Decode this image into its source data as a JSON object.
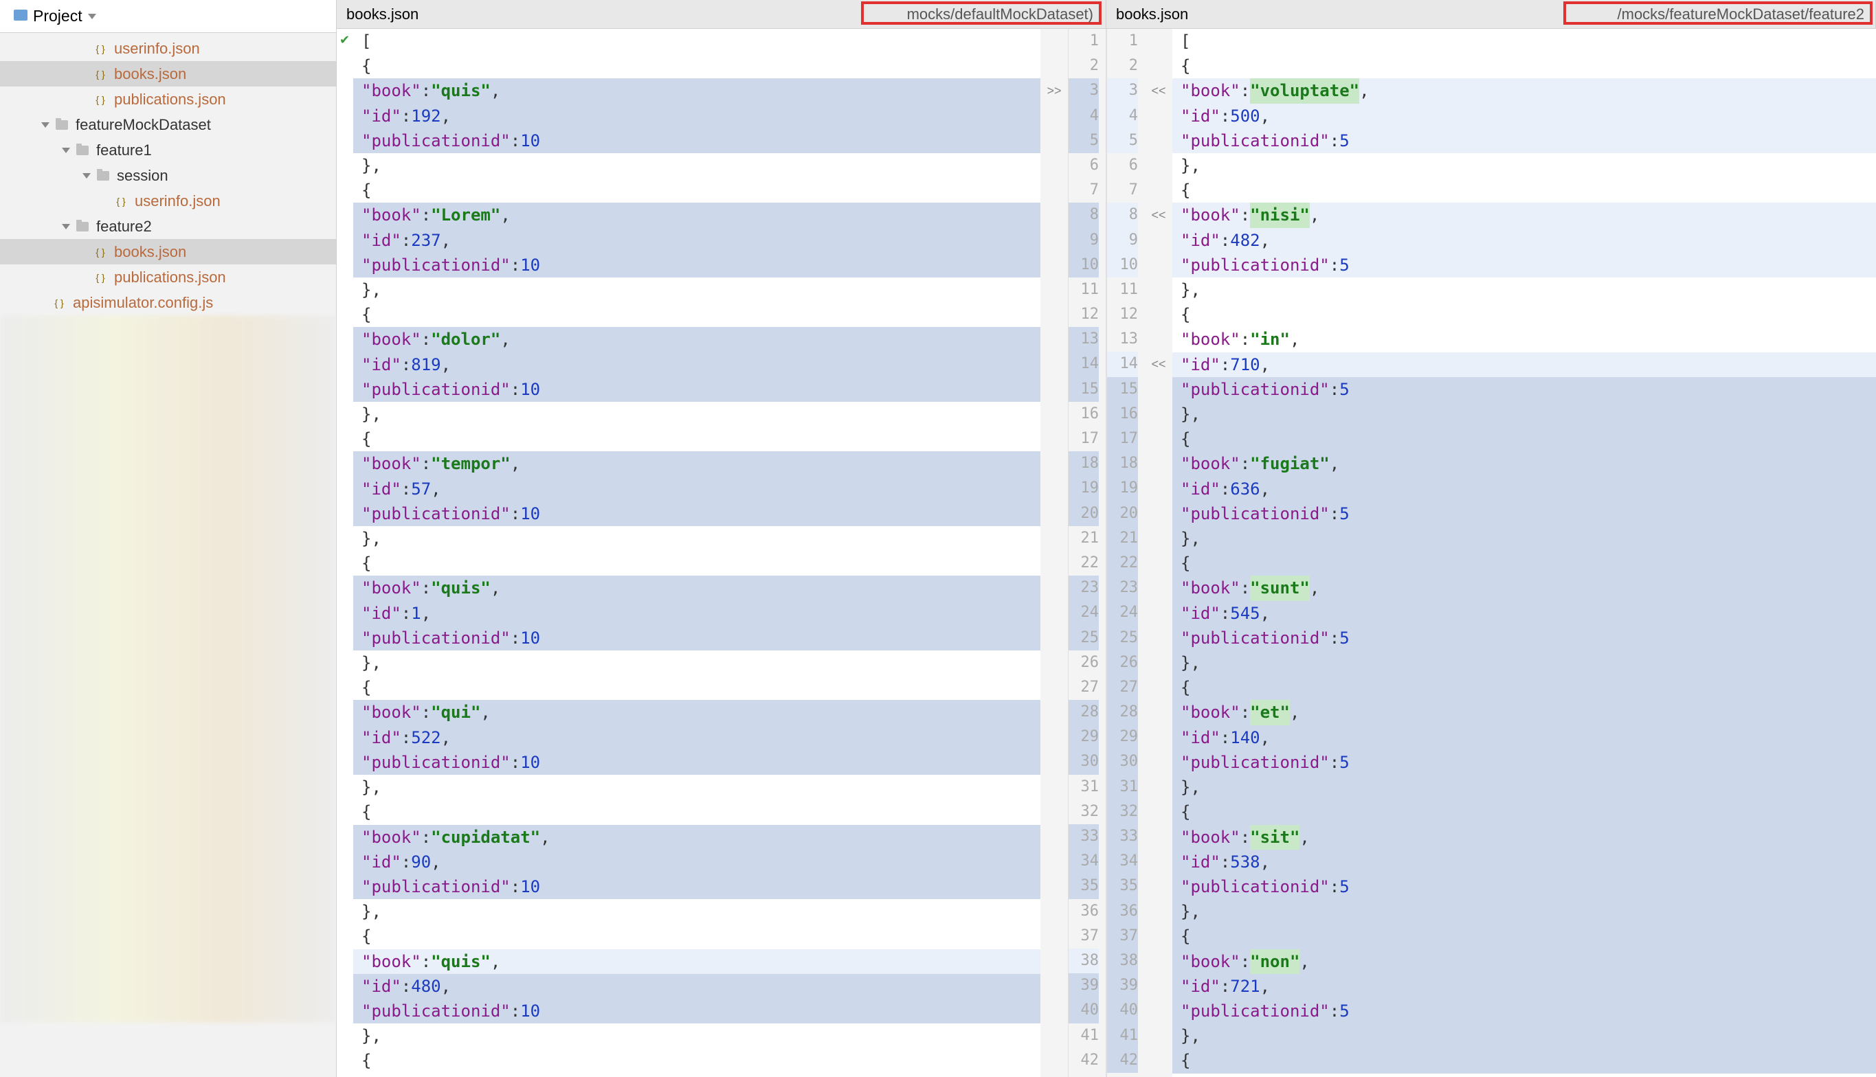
{
  "sidebar": {
    "header": "Project",
    "tree": [
      {
        "indent": 4,
        "icon": "json",
        "label": "userinfo.json",
        "vcs": true
      },
      {
        "indent": 4,
        "icon": "json",
        "label": "books.json",
        "vcs": true,
        "selected": true
      },
      {
        "indent": 4,
        "icon": "json",
        "label": "publications.json",
        "vcs": true
      },
      {
        "indent": 2,
        "icon": "folder",
        "label": "featureMockDataset",
        "tri": true
      },
      {
        "indent": 3,
        "icon": "folder",
        "label": "feature1",
        "tri": true
      },
      {
        "indent": 4,
        "icon": "folder",
        "label": "session",
        "tri": true
      },
      {
        "indent": 5,
        "icon": "json",
        "label": "userinfo.json",
        "vcs": true
      },
      {
        "indent": 3,
        "icon": "folder",
        "label": "feature2",
        "tri": true
      },
      {
        "indent": 4,
        "icon": "json",
        "label": "books.json",
        "vcs": true,
        "selected": true
      },
      {
        "indent": 4,
        "icon": "json",
        "label": "publications.json",
        "vcs": true
      },
      {
        "indent": 2,
        "icon": "js",
        "label": "apisimulator.config.js",
        "vcs": true
      }
    ]
  },
  "tabs": {
    "left": {
      "file": "books.json",
      "path": "mocks/defaultMockDataset)"
    },
    "right": {
      "file": "books.json",
      "path": "/mocks/featureMockDataset/feature2"
    }
  },
  "leftFile": [
    {
      "n": 1,
      "t": "[",
      "d": ""
    },
    {
      "n": 2,
      "t": "  {",
      "d": ""
    },
    {
      "n": 3,
      "t": "    \"book\": \"quis\",",
      "d": "blue",
      "markL": ">>"
    },
    {
      "n": 4,
      "t": "    \"id\": 192,",
      "d": "blue"
    },
    {
      "n": 5,
      "t": "    \"publicationid\": 10",
      "d": "blue"
    },
    {
      "n": 6,
      "t": "  },",
      "d": ""
    },
    {
      "n": 7,
      "t": "  {",
      "d": ""
    },
    {
      "n": 8,
      "t": "    \"book\": \"Lorem\",",
      "d": "blue"
    },
    {
      "n": 9,
      "t": "    \"id\": 237,",
      "d": "blue"
    },
    {
      "n": 10,
      "t": "    \"publicationid\": 10",
      "d": "blue"
    },
    {
      "n": 11,
      "t": "  },",
      "d": ""
    },
    {
      "n": 12,
      "t": "  {",
      "d": ""
    },
    {
      "n": 13,
      "t": "    \"book\": \"dolor\",",
      "d": "blue"
    },
    {
      "n": 14,
      "t": "    \"id\": 819,",
      "d": "blue"
    },
    {
      "n": 15,
      "t": "    \"publicationid\": 10",
      "d": "blue"
    },
    {
      "n": 16,
      "t": "  },",
      "d": ""
    },
    {
      "n": 17,
      "t": "  {",
      "d": ""
    },
    {
      "n": 18,
      "t": "    \"book\": \"tempor\",",
      "d": "blue"
    },
    {
      "n": 19,
      "t": "    \"id\": 57,",
      "d": "blue"
    },
    {
      "n": 20,
      "t": "    \"publicationid\": 10",
      "d": "blue"
    },
    {
      "n": 21,
      "t": "  },",
      "d": ""
    },
    {
      "n": 22,
      "t": "  {",
      "d": ""
    },
    {
      "n": 23,
      "t": "    \"book\": \"quis\",",
      "d": "blue"
    },
    {
      "n": 24,
      "t": "    \"id\": 1,",
      "d": "blue"
    },
    {
      "n": 25,
      "t": "    \"publicationid\": 10",
      "d": "blue"
    },
    {
      "n": 26,
      "t": "  },",
      "d": ""
    },
    {
      "n": 27,
      "t": "  {",
      "d": ""
    },
    {
      "n": 28,
      "t": "    \"book\": \"qui\",",
      "d": "blue"
    },
    {
      "n": 29,
      "t": "    \"id\": 522,",
      "d": "blue"
    },
    {
      "n": 30,
      "t": "    \"publicationid\": 10",
      "d": "blue"
    },
    {
      "n": 31,
      "t": "  },",
      "d": ""
    },
    {
      "n": 32,
      "t": "  {",
      "d": ""
    },
    {
      "n": 33,
      "t": "    \"book\": \"cupidatat\",",
      "d": "blue"
    },
    {
      "n": 34,
      "t": "    \"id\": 90,",
      "d": "blue"
    },
    {
      "n": 35,
      "t": "    \"publicationid\": 10",
      "d": "blue"
    },
    {
      "n": 36,
      "t": "  },",
      "d": ""
    },
    {
      "n": 37,
      "t": "  {",
      "d": ""
    },
    {
      "n": 38,
      "t": "    \"book\": \"quis\",",
      "d": "light"
    },
    {
      "n": 39,
      "t": "    \"id\": 480,",
      "d": "blue"
    },
    {
      "n": 40,
      "t": "    \"publicationid\": 10",
      "d": "blue"
    },
    {
      "n": 41,
      "t": "  },",
      "d": ""
    },
    {
      "n": 42,
      "t": "  {",
      "d": ""
    }
  ],
  "rightFile": [
    {
      "n": 1,
      "t": "[",
      "d": ""
    },
    {
      "n": 2,
      "t": "  {",
      "d": ""
    },
    {
      "n": 3,
      "t": "    \"book\": \"voluptate\",",
      "d": "light",
      "markR": "<<",
      "hl": true
    },
    {
      "n": 4,
      "t": "    \"id\": 500,",
      "d": "light"
    },
    {
      "n": 5,
      "t": "    \"publicationid\": 5",
      "d": "light"
    },
    {
      "n": 6,
      "t": "  },",
      "d": ""
    },
    {
      "n": 7,
      "t": "  {",
      "d": ""
    },
    {
      "n": 8,
      "t": "    \"book\": \"nisi\",",
      "d": "light",
      "markR": "<<",
      "hl": true
    },
    {
      "n": 9,
      "t": "    \"id\": 482,",
      "d": "light"
    },
    {
      "n": 10,
      "t": "    \"publicationid\": 5",
      "d": "light"
    },
    {
      "n": 11,
      "t": "  },",
      "d": ""
    },
    {
      "n": 12,
      "t": "  {",
      "d": ""
    },
    {
      "n": 13,
      "t": "    \"book\": \"in\",",
      "d": ""
    },
    {
      "n": 14,
      "t": "    \"id\": 710,",
      "d": "light",
      "markR": "<<"
    },
    {
      "n": 15,
      "t": "    \"publicationid\": 5",
      "d": "blue"
    },
    {
      "n": 16,
      "t": "  },",
      "d": "blue"
    },
    {
      "n": 17,
      "t": "  {",
      "d": "blue"
    },
    {
      "n": 18,
      "t": "    \"book\": \"fugiat\",",
      "d": "blue"
    },
    {
      "n": 19,
      "t": "    \"id\": 636,",
      "d": "blue"
    },
    {
      "n": 20,
      "t": "    \"publicationid\": 5",
      "d": "blue"
    },
    {
      "n": 21,
      "t": "  },",
      "d": "blue"
    },
    {
      "n": 22,
      "t": "  {",
      "d": "blue"
    },
    {
      "n": 23,
      "t": "    \"book\": \"sunt\",",
      "d": "blue",
      "hl": true
    },
    {
      "n": 24,
      "t": "    \"id\": 545,",
      "d": "blue"
    },
    {
      "n": 25,
      "t": "    \"publicationid\": 5",
      "d": "blue"
    },
    {
      "n": 26,
      "t": "  },",
      "d": "blue"
    },
    {
      "n": 27,
      "t": "  {",
      "d": "blue"
    },
    {
      "n": 28,
      "t": "    \"book\": \"et\",",
      "d": "blue",
      "hl": true
    },
    {
      "n": 29,
      "t": "    \"id\": 140,",
      "d": "blue"
    },
    {
      "n": 30,
      "t": "    \"publicationid\": 5",
      "d": "blue"
    },
    {
      "n": 31,
      "t": "  },",
      "d": "blue"
    },
    {
      "n": 32,
      "t": "  {",
      "d": "blue"
    },
    {
      "n": 33,
      "t": "    \"book\": \"sit\",",
      "d": "blue",
      "hl": true
    },
    {
      "n": 34,
      "t": "    \"id\": 538,",
      "d": "blue"
    },
    {
      "n": 35,
      "t": "    \"publicationid\": 5",
      "d": "blue"
    },
    {
      "n": 36,
      "t": "  },",
      "d": "blue"
    },
    {
      "n": 37,
      "t": "  {",
      "d": "blue"
    },
    {
      "n": 38,
      "t": "    \"book\": \"non\",",
      "d": "blue",
      "hl": true
    },
    {
      "n": 39,
      "t": "    \"id\": 721,",
      "d": "blue"
    },
    {
      "n": 40,
      "t": "    \"publicationid\": 5",
      "d": "blue"
    },
    {
      "n": 41,
      "t": "  },",
      "d": "blue"
    },
    {
      "n": 42,
      "t": "  {",
      "d": "blue"
    }
  ]
}
